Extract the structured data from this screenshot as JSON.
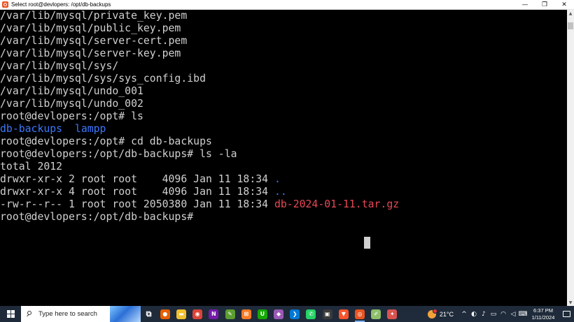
{
  "window": {
    "title": "Select root@devlopers: /opt/db-backups",
    "minimize_glyph": "—",
    "maximize_glyph": "❐",
    "close_glyph": "✕"
  },
  "terminal": {
    "lines": [
      {
        "segments": [
          {
            "text": "/var/lib/mysql/private_key.pem",
            "color": "default"
          }
        ]
      },
      {
        "segments": [
          {
            "text": "/var/lib/mysql/public_key.pem",
            "color": "default"
          }
        ]
      },
      {
        "segments": [
          {
            "text": "/var/lib/mysql/server-cert.pem",
            "color": "default"
          }
        ]
      },
      {
        "segments": [
          {
            "text": "/var/lib/mysql/server-key.pem",
            "color": "default"
          }
        ]
      },
      {
        "segments": [
          {
            "text": "/var/lib/mysql/sys/",
            "color": "default"
          }
        ]
      },
      {
        "segments": [
          {
            "text": "/var/lib/mysql/sys/sys_config.ibd",
            "color": "default"
          }
        ]
      },
      {
        "segments": [
          {
            "text": "/var/lib/mysql/undo_001",
            "color": "default"
          }
        ]
      },
      {
        "segments": [
          {
            "text": "/var/lib/mysql/undo_002",
            "color": "default"
          }
        ]
      },
      {
        "segments": [
          {
            "text": "root@devlopers:/opt# ls",
            "color": "default"
          }
        ]
      },
      {
        "segments": [
          {
            "text": "db-backups",
            "color": "blue"
          },
          {
            "text": "  ",
            "color": "default"
          },
          {
            "text": "lampp",
            "color": "blue"
          }
        ]
      },
      {
        "segments": [
          {
            "text": "root@devlopers:/opt# cd db-backups",
            "color": "default"
          }
        ]
      },
      {
        "segments": [
          {
            "text": "root@devlopers:/opt/db-backups# ls -la",
            "color": "default"
          }
        ]
      },
      {
        "segments": [
          {
            "text": "total 2012",
            "color": "default"
          }
        ]
      },
      {
        "segments": [
          {
            "text": "drwxr-xr-x 2 root root    4096 Jan 11 18:34 ",
            "color": "default"
          },
          {
            "text": ".",
            "color": "blue"
          }
        ]
      },
      {
        "segments": [
          {
            "text": "drwxr-xr-x 4 root root    4096 Jan 11 18:34 ",
            "color": "default"
          },
          {
            "text": "..",
            "color": "blue"
          }
        ]
      },
      {
        "segments": [
          {
            "text": "-rw-r--r-- 1 root root 2050380 Jan 11 18:34 ",
            "color": "default"
          },
          {
            "text": "db-2024-01-11.tar.gz",
            "color": "red"
          }
        ]
      },
      {
        "segments": [
          {
            "text": "root@devlopers:/opt/db-backups#",
            "color": "default"
          }
        ]
      }
    ],
    "colors": {
      "default": "#d0d0d0",
      "blue": "#3b78ff",
      "red": "#e74856",
      "background": "#000000"
    }
  },
  "scrollbar": {
    "up_glyph": "▲",
    "down_glyph": "▼"
  },
  "taskbar": {
    "search_placeholder": "Type here to search",
    "apps": [
      {
        "name": "task-view-icon",
        "glyph": "⧉",
        "bg": "transparent",
        "active": false
      },
      {
        "name": "firefox-icon",
        "glyph": "●",
        "bg": "#e66000",
        "active": false
      },
      {
        "name": "file-explorer-icon",
        "glyph": "▬",
        "bg": "#f2c12e",
        "active": false
      },
      {
        "name": "chrome-icon",
        "glyph": "◉",
        "bg": "#db4437",
        "active": false
      },
      {
        "name": "onenote-icon",
        "glyph": "N",
        "bg": "#7719aa",
        "active": false
      },
      {
        "name": "notepad-plus-plus-icon",
        "glyph": "✎",
        "bg": "#5c9e31",
        "active": false
      },
      {
        "name": "xampp-icon",
        "glyph": "⊠",
        "bg": "#fb7a24",
        "active": false
      },
      {
        "name": "upwork-icon",
        "glyph": "U",
        "bg": "#14a800",
        "active": false
      },
      {
        "name": "gitkraken-icon",
        "glyph": "◆",
        "bg": "#9b59b6",
        "active": false
      },
      {
        "name": "vscode-icon",
        "glyph": "❯",
        "bg": "#0078d4",
        "active": false
      },
      {
        "name": "whatsapp-icon",
        "glyph": "✆",
        "bg": "#25d366",
        "active": false
      },
      {
        "name": "media-player-icon",
        "glyph": "▣",
        "bg": "#3a3a3a",
        "active": false
      },
      {
        "name": "brave-icon",
        "glyph": "▼",
        "bg": "#fb542b",
        "active": false
      },
      {
        "name": "ubuntu-terminal-icon",
        "glyph": "◎",
        "bg": "#e95420",
        "active": true
      },
      {
        "name": "sticky-tool-icon",
        "glyph": "✐",
        "bg": "#8fbf6a",
        "active": false
      },
      {
        "name": "paint-icon",
        "glyph": "✦",
        "bg": "#d9534f",
        "active": false
      }
    ],
    "weather_temp": "21°C",
    "tray": [
      {
        "name": "chevron-up-icon",
        "glyph": "^"
      },
      {
        "name": "meet-now-icon",
        "glyph": "◐"
      },
      {
        "name": "microphone-icon",
        "glyph": "♪"
      },
      {
        "name": "battery-icon",
        "glyph": "▭"
      },
      {
        "name": "network-icon",
        "glyph": "◠"
      },
      {
        "name": "volume-icon",
        "glyph": "◁"
      },
      {
        "name": "keyboard-icon",
        "glyph": "⌨"
      }
    ],
    "time": "6:37 PM",
    "date": "1/11/2024"
  }
}
